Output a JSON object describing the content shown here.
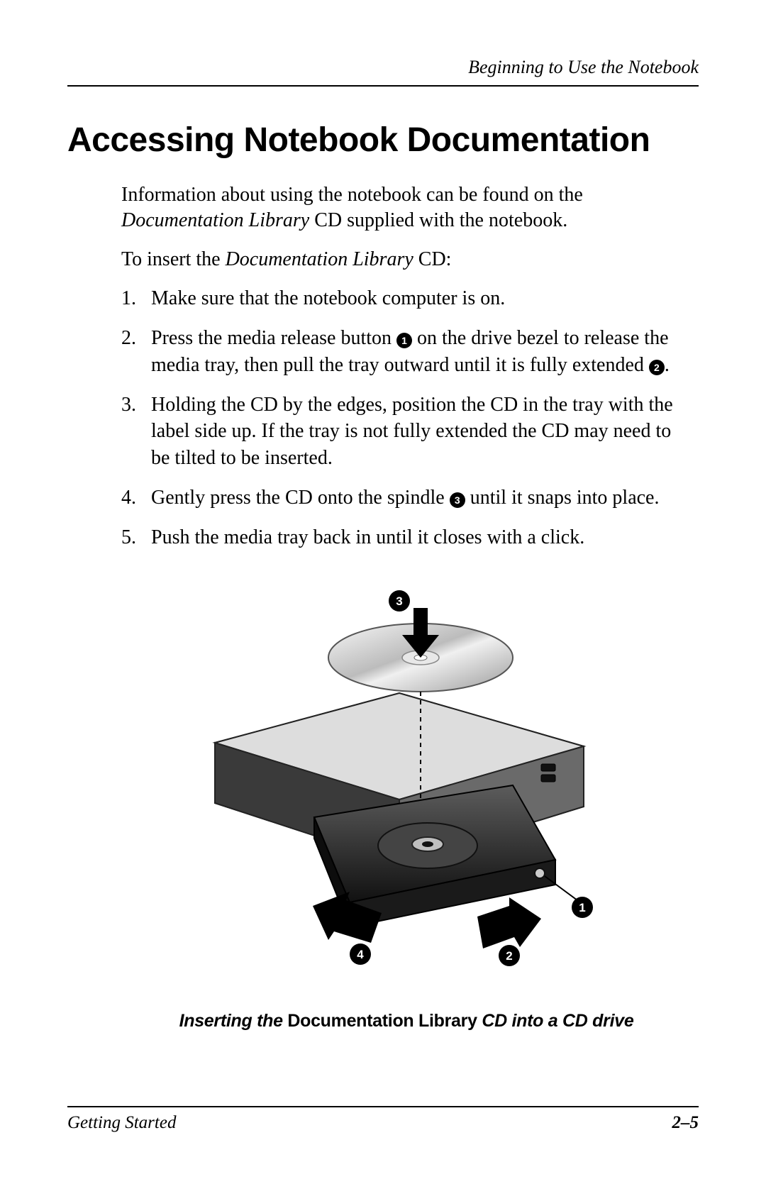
{
  "header": {
    "section": "Beginning to Use the Notebook"
  },
  "title": "Accessing Notebook Documentation",
  "intro": {
    "pre": "Information about using the notebook can be found on the ",
    "em": "Documentation Library",
    "post": " CD supplied with the notebook."
  },
  "lead": {
    "pre": "To insert the ",
    "em": "Documentation Library",
    "post": " CD:"
  },
  "steps": {
    "s1": "Make sure that the notebook computer is on.",
    "s2a": "Press the media release button ",
    "s2n1": "1",
    "s2b": " on the drive bezel to release the media tray, then pull the tray outward until it is fully extended ",
    "s2n2": "2",
    "s2c": ".",
    "s3": "Holding the CD by the edges, position the CD in the tray with the label side up. If the tray is not fully extended the CD may need to be tilted to be inserted.",
    "s4a": "Gently press the CD onto the spindle ",
    "s4n3": "3",
    "s4b": " until it snaps into place.",
    "s5": "Push the media tray back in until it closes with a click."
  },
  "figure": {
    "callouts": {
      "n1": "1",
      "n2": "2",
      "n3": "3",
      "n4": "4"
    }
  },
  "caption": {
    "pre_i": "Inserting the ",
    "mid_b": "Documentation Library",
    "post_i": " CD into a CD drive"
  },
  "footer": {
    "left": "Getting Started",
    "right": "2–5"
  }
}
